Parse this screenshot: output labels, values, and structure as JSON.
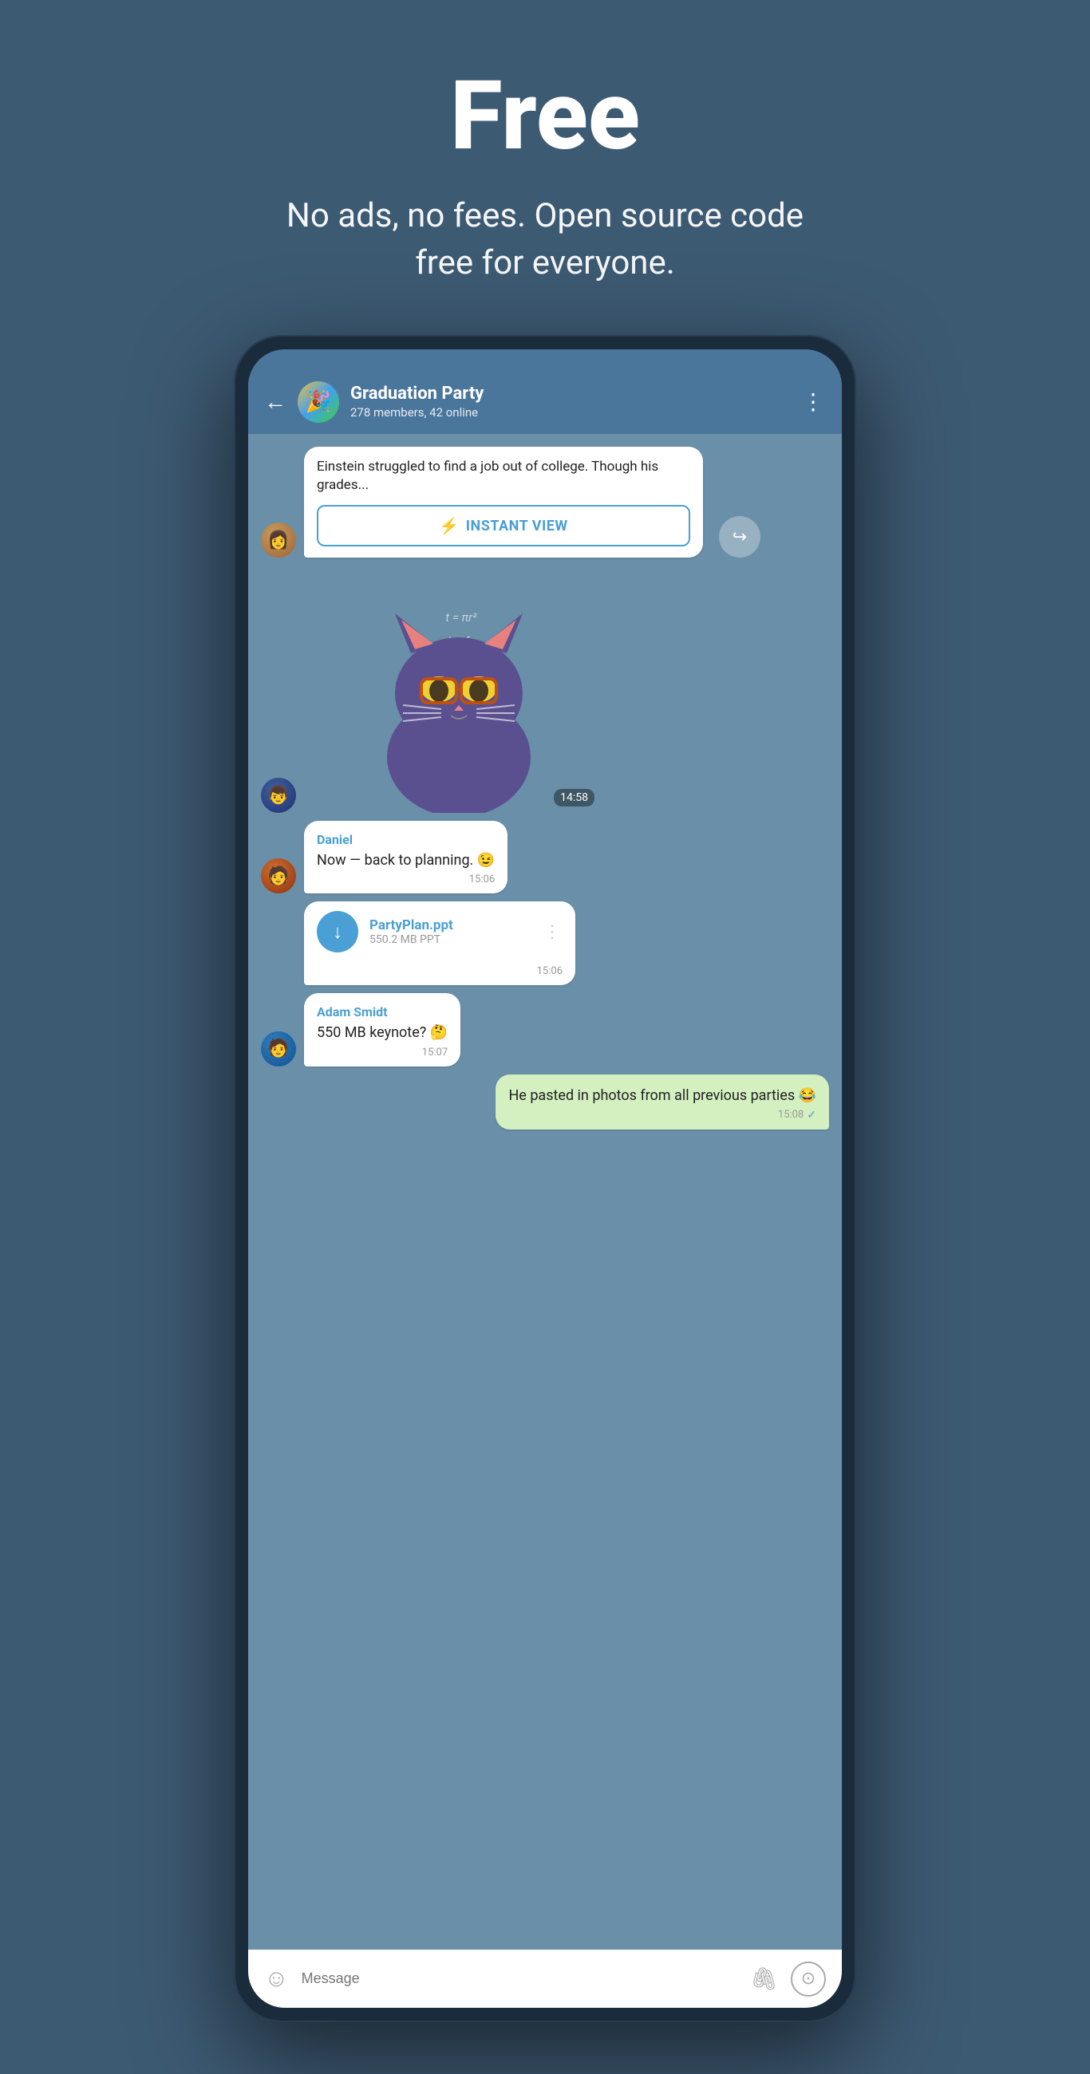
{
  "hero": {
    "title": "Free",
    "subtitle": "No ads, no fees. Open source code free for everyone."
  },
  "phone": {
    "chat": {
      "name": "Graduation Party",
      "status": "278 members, 42 online",
      "back_label": "←",
      "more_label": "⋮"
    },
    "messages": [
      {
        "id": "article-msg",
        "type": "article",
        "text": "Einstein struggled to find a job out of college. Though his grades...",
        "instant_view_label": "INSTANT VIEW"
      },
      {
        "id": "sticker-msg",
        "type": "sticker",
        "time": "14:58"
      },
      {
        "id": "daniel-msg",
        "type": "text",
        "sender": "Daniel",
        "text": "Now — back to planning. 😉",
        "time": "15:06"
      },
      {
        "id": "file-msg",
        "type": "file",
        "file_name": "PartyPlan.ppt",
        "file_size": "550.2 MB PPT",
        "time": "15:06"
      },
      {
        "id": "adam-msg",
        "type": "text",
        "sender": "Adam Smidt",
        "text": "550 MB keynote? 🤔",
        "time": "15:07"
      },
      {
        "id": "self-msg",
        "type": "text",
        "sender": "",
        "text": "He pasted in photos from all previous parties 😂",
        "time": "15:08",
        "is_self": true,
        "check": "✓"
      }
    ],
    "input": {
      "placeholder": "Message"
    }
  },
  "icons": {
    "lightning": "⚡",
    "back_arrow": "←",
    "more_dots": "⋮",
    "share": "↪",
    "download": "↓",
    "emoji": "☺",
    "attach": "📎",
    "camera": "⊙"
  }
}
